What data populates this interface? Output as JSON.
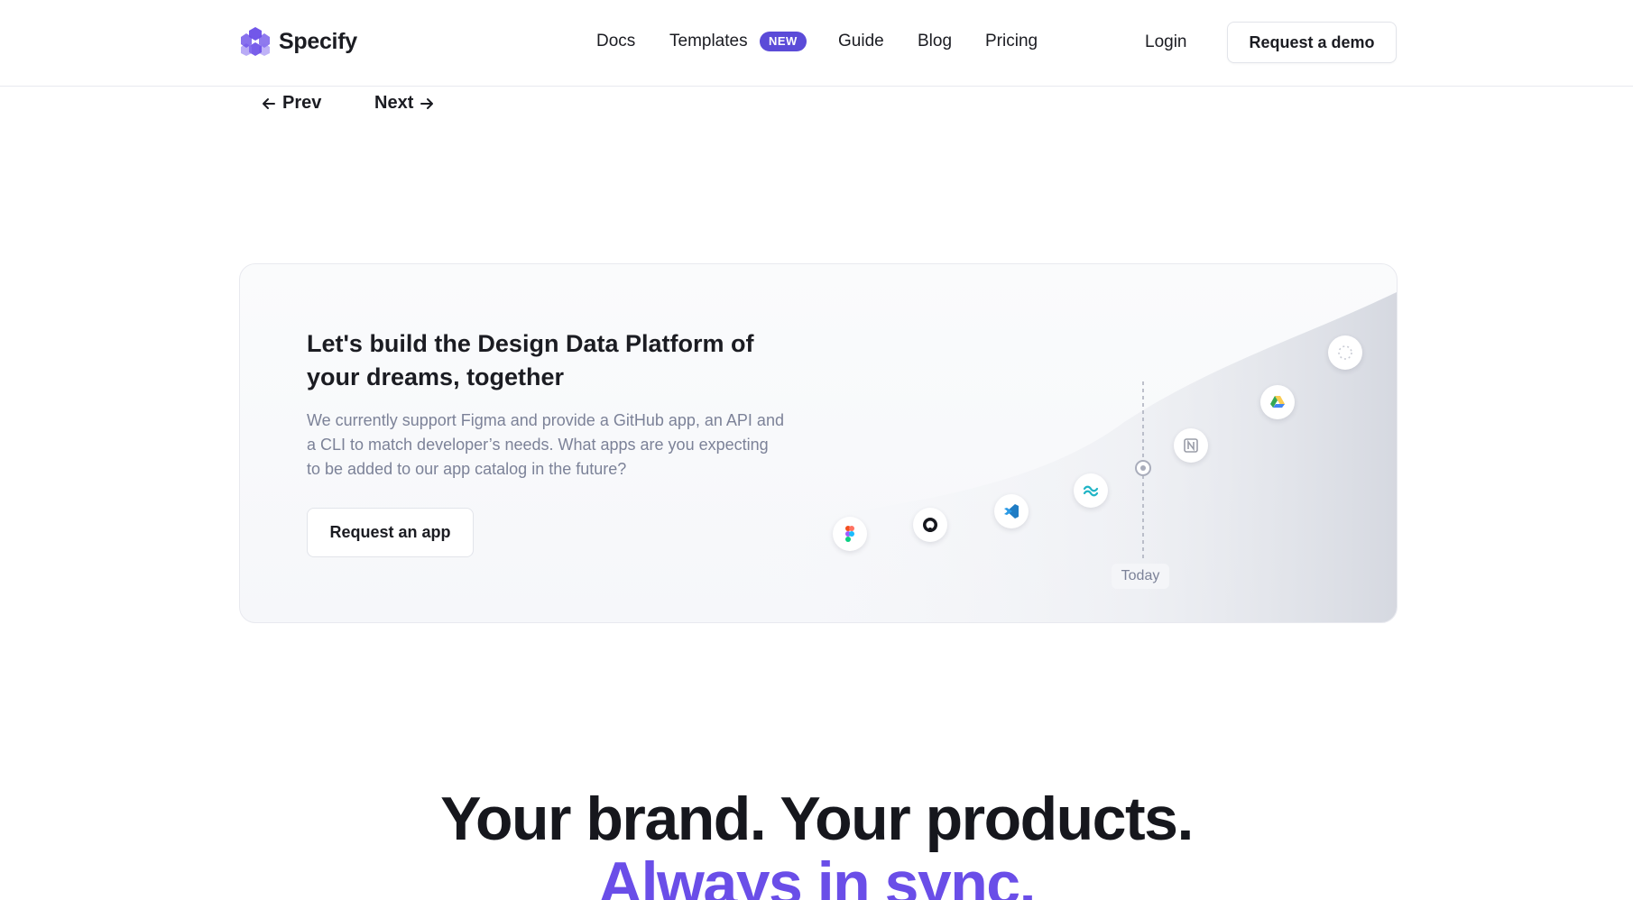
{
  "header": {
    "brand": "Specify",
    "nav": {
      "docs": "Docs",
      "templates": "Templates",
      "templates_badge": "NEW",
      "guide": "Guide",
      "blog": "Blog",
      "pricing": "Pricing"
    },
    "login": "Login",
    "demo": "Request a demo",
    "accent": "#5b4bd8"
  },
  "pager": {
    "prev": "Prev",
    "next": "Next"
  },
  "card": {
    "title": "Let's build the Design Data Platform of your dreams, together",
    "description": "We currently support Figma and provide a GitHub app, an API and a CLI to match developer’s needs. What apps are you expecting to be added to our app catalog in the future?",
    "button": "Request an app",
    "timeline_label": "Today",
    "apps": [
      "figma-icon",
      "github-icon",
      "vscode-icon",
      "tailwind-icon",
      "notion-icon",
      "google-drive-icon",
      "future-app-icon"
    ]
  },
  "hero": {
    "line1": "Your brand. Your products.",
    "line2": "Always in sync.",
    "line2_color": "#6a4ee8"
  }
}
